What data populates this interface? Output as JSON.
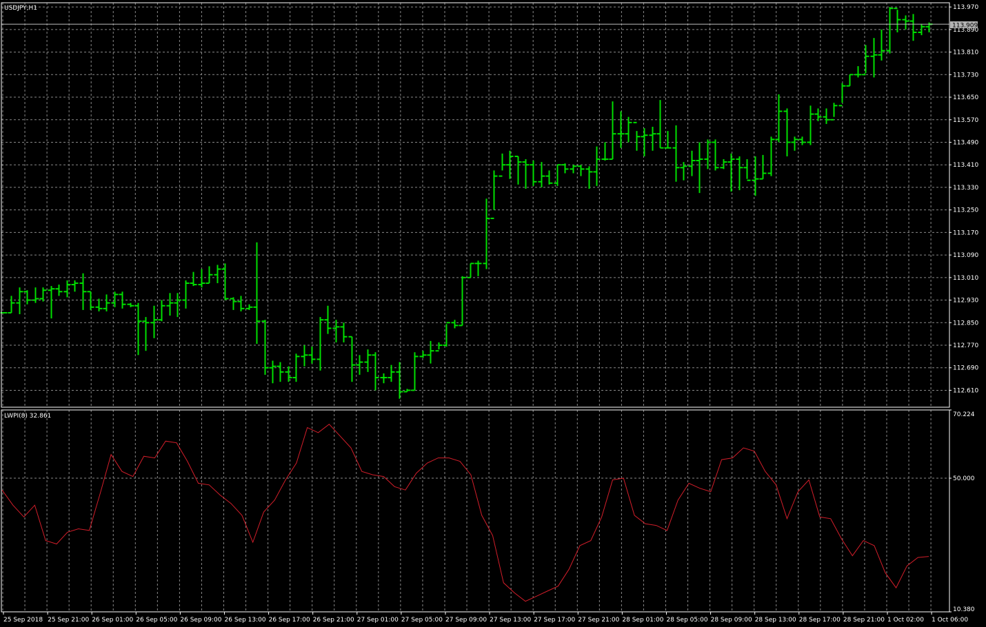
{
  "price_panel": {
    "symbol_label": "USDJPY,H1",
    "current_price_label": "113.909",
    "colors": {
      "bar": "#00e000",
      "grid": "#8a8a8a",
      "price_line": "#c0c0c0",
      "price_tag": "#b3b3b3",
      "frame": "#ffffff",
      "background": "#000000"
    }
  },
  "indicator_panel": {
    "label": "LWPI(8) 32.861",
    "colors": {
      "line": "#d21e2a",
      "level": "#8a8a8a"
    }
  },
  "chart_data": [
    {
      "type": "ohlc",
      "title": "USDJPY,H1",
      "ylim": [
        112.55,
        113.985
      ],
      "y_ticks": [
        "113.970",
        "113.890",
        "113.810",
        "113.730",
        "113.650",
        "113.570",
        "113.490",
        "113.410",
        "113.330",
        "113.250",
        "113.170",
        "113.090",
        "113.010",
        "112.930",
        "112.850",
        "112.770",
        "112.690",
        "112.610"
      ],
      "current_price": 113.909,
      "x_ticks": [
        "25 Sep 2018",
        "25 Sep 21:00",
        "26 Sep 01:00",
        "26 Sep 05:00",
        "26 Sep 09:00",
        "26 Sep 13:00",
        "26 Sep 17:00",
        "26 Sep 21:00",
        "27 Sep 01:00",
        "27 Sep 05:00",
        "27 Sep 09:00",
        "27 Sep 13:00",
        "27 Sep 17:00",
        "27 Sep 21:00",
        "28 Sep 01:00",
        "28 Sep 05:00",
        "28 Sep 09:00",
        "28 Sep 13:00",
        "28 Sep 17:00",
        "28 Sep 21:00",
        "1 Oct 02:00",
        "1 Oct 06:00"
      ],
      "bars": [
        {
          "o": 112.885,
          "h": 112.885,
          "l": 112.885,
          "c": 112.885
        },
        {
          "o": 112.885,
          "h": 112.945,
          "l": 112.885,
          "c": 112.92
        },
        {
          "o": 112.92,
          "h": 112.975,
          "l": 112.88,
          "c": 112.96
        },
        {
          "o": 112.96,
          "h": 112.965,
          "l": 112.915,
          "c": 112.93
        },
        {
          "o": 112.93,
          "h": 112.975,
          "l": 112.92,
          "c": 112.935
        },
        {
          "o": 112.935,
          "h": 112.975,
          "l": 112.925,
          "c": 112.965
        },
        {
          "o": 112.965,
          "h": 112.98,
          "l": 112.865,
          "c": 112.97
        },
        {
          "o": 112.97,
          "h": 112.985,
          "l": 112.945,
          "c": 112.96
        },
        {
          "o": 112.96,
          "h": 113.0,
          "l": 112.94,
          "c": 112.985
        },
        {
          "o": 112.985,
          "h": 113.0,
          "l": 112.96,
          "c": 112.99
        },
        {
          "o": 112.99,
          "h": 113.025,
          "l": 112.895,
          "c": 112.96
        },
        {
          "o": 112.96,
          "h": 112.96,
          "l": 112.895,
          "c": 112.905
        },
        {
          "o": 112.905,
          "h": 112.935,
          "l": 112.89,
          "c": 112.9
        },
        {
          "o": 112.9,
          "h": 112.95,
          "l": 112.89,
          "c": 112.92
        },
        {
          "o": 112.92,
          "h": 112.96,
          "l": 112.905,
          "c": 112.95
        },
        {
          "o": 112.95,
          "h": 112.96,
          "l": 112.9,
          "c": 112.915
        },
        {
          "o": 112.915,
          "h": 112.92,
          "l": 112.905,
          "c": 112.91
        },
        {
          "o": 112.91,
          "h": 112.92,
          "l": 112.735,
          "c": 112.855
        },
        {
          "o": 112.855,
          "h": 112.87,
          "l": 112.75,
          "c": 112.85
        },
        {
          "o": 112.85,
          "h": 112.91,
          "l": 112.795,
          "c": 112.86
        },
        {
          "o": 112.86,
          "h": 112.93,
          "l": 112.855,
          "c": 112.91
        },
        {
          "o": 112.91,
          "h": 112.955,
          "l": 112.875,
          "c": 112.92
        },
        {
          "o": 112.92,
          "h": 112.955,
          "l": 112.87,
          "c": 112.93
        },
        {
          "o": 112.93,
          "h": 113.0,
          "l": 112.9,
          "c": 112.99
        },
        {
          "o": 112.99,
          "h": 113.03,
          "l": 112.98,
          "c": 112.985
        },
        {
          "o": 112.985,
          "h": 113.04,
          "l": 112.975,
          "c": 112.99
        },
        {
          "o": 112.99,
          "h": 113.05,
          "l": 112.99,
          "c": 113.02
        },
        {
          "o": 113.02,
          "h": 113.055,
          "l": 112.99,
          "c": 113.04
        },
        {
          "o": 113.04,
          "h": 113.06,
          "l": 112.93,
          "c": 112.935
        },
        {
          "o": 112.935,
          "h": 112.94,
          "l": 112.895,
          "c": 112.925
        },
        {
          "o": 112.925,
          "h": 112.945,
          "l": 112.89,
          "c": 112.9
        },
        {
          "o": 112.9,
          "h": 112.915,
          "l": 112.895,
          "c": 112.905
        },
        {
          "o": 112.905,
          "h": 113.135,
          "l": 112.775,
          "c": 112.855
        },
        {
          "o": 112.855,
          "h": 112.86,
          "l": 112.665,
          "c": 112.69
        },
        {
          "o": 112.69,
          "h": 112.715,
          "l": 112.635,
          "c": 112.695
        },
        {
          "o": 112.695,
          "h": 112.71,
          "l": 112.64,
          "c": 112.675
        },
        {
          "o": 112.675,
          "h": 112.695,
          "l": 112.64,
          "c": 112.655
        },
        {
          "o": 112.655,
          "h": 112.74,
          "l": 112.64,
          "c": 112.73
        },
        {
          "o": 112.73,
          "h": 112.77,
          "l": 112.695,
          "c": 112.735
        },
        {
          "o": 112.735,
          "h": 112.765,
          "l": 112.705,
          "c": 112.72
        },
        {
          "o": 112.72,
          "h": 112.87,
          "l": 112.68,
          "c": 112.86
        },
        {
          "o": 112.86,
          "h": 112.91,
          "l": 112.81,
          "c": 112.83
        },
        {
          "o": 112.83,
          "h": 112.86,
          "l": 112.78,
          "c": 112.835
        },
        {
          "o": 112.835,
          "h": 112.85,
          "l": 112.78,
          "c": 112.8
        },
        {
          "o": 112.8,
          "h": 112.8,
          "l": 112.64,
          "c": 112.7
        },
        {
          "o": 112.7,
          "h": 112.735,
          "l": 112.665,
          "c": 112.71
        },
        {
          "o": 112.71,
          "h": 112.755,
          "l": 112.675,
          "c": 112.735
        },
        {
          "o": 112.735,
          "h": 112.745,
          "l": 112.61,
          "c": 112.655
        },
        {
          "o": 112.655,
          "h": 112.67,
          "l": 112.635,
          "c": 112.655
        },
        {
          "o": 112.655,
          "h": 112.7,
          "l": 112.64,
          "c": 112.675
        },
        {
          "o": 112.675,
          "h": 112.71,
          "l": 112.58,
          "c": 112.605
        },
        {
          "o": 112.605,
          "h": 112.615,
          "l": 112.605,
          "c": 112.61
        },
        {
          "o": 112.61,
          "h": 112.745,
          "l": 112.61,
          "c": 112.73
        },
        {
          "o": 112.73,
          "h": 112.75,
          "l": 112.725,
          "c": 112.735
        },
        {
          "o": 112.735,
          "h": 112.785,
          "l": 112.705,
          "c": 112.75
        },
        {
          "o": 112.75,
          "h": 112.78,
          "l": 112.755,
          "c": 112.77
        },
        {
          "o": 112.77,
          "h": 112.845,
          "l": 112.765,
          "c": 112.85
        },
        {
          "o": 112.85,
          "h": 112.86,
          "l": 112.83,
          "c": 112.84
        },
        {
          "o": 112.84,
          "h": 113.015,
          "l": 112.84,
          "c": 113.01
        },
        {
          "o": 113.01,
          "h": 113.06,
          "l": 113.01,
          "c": 113.06
        },
        {
          "o": 113.06,
          "h": 113.07,
          "l": 113.015,
          "c": 113.06
        },
        {
          "o": 113.06,
          "h": 113.29,
          "l": 113.04,
          "c": 113.22
        },
        {
          "o": 113.22,
          "h": 113.39,
          "l": 113.25,
          "c": 113.37
        },
        {
          "o": 113.37,
          "h": 113.45,
          "l": 113.39,
          "c": 113.41
        },
        {
          "o": 113.41,
          "h": 113.46,
          "l": 113.36,
          "c": 113.44
        },
        {
          "o": 113.44,
          "h": 113.44,
          "l": 113.34,
          "c": 113.42
        },
        {
          "o": 113.42,
          "h": 113.43,
          "l": 113.325,
          "c": 113.41
        },
        {
          "o": 113.41,
          "h": 113.425,
          "l": 113.335,
          "c": 113.35
        },
        {
          "o": 113.35,
          "h": 113.42,
          "l": 113.33,
          "c": 113.37
        },
        {
          "o": 113.37,
          "h": 113.39,
          "l": 113.34,
          "c": 113.345
        },
        {
          "o": 113.345,
          "h": 113.41,
          "l": 113.335,
          "c": 113.41
        },
        {
          "o": 113.41,
          "h": 113.415,
          "l": 113.38,
          "c": 113.395
        },
        {
          "o": 113.395,
          "h": 113.41,
          "l": 113.38,
          "c": 113.405
        },
        {
          "o": 113.405,
          "h": 113.41,
          "l": 113.37,
          "c": 113.395
        },
        {
          "o": 113.395,
          "h": 113.405,
          "l": 113.325,
          "c": 113.385
        },
        {
          "o": 113.385,
          "h": 113.475,
          "l": 113.335,
          "c": 113.43
        },
        {
          "o": 113.43,
          "h": 113.49,
          "l": 113.425,
          "c": 113.43
        },
        {
          "o": 113.43,
          "h": 113.635,
          "l": 113.43,
          "c": 113.52
        },
        {
          "o": 113.52,
          "h": 113.6,
          "l": 113.47,
          "c": 113.52
        },
        {
          "o": 113.52,
          "h": 113.58,
          "l": 113.49,
          "c": 113.56
        },
        {
          "o": 113.56,
          "h": 113.53,
          "l": 113.46,
          "c": 113.51
        },
        {
          "o": 113.51,
          "h": 113.54,
          "l": 113.44,
          "c": 113.515
        },
        {
          "o": 113.515,
          "h": 113.545,
          "l": 113.46,
          "c": 113.52
        },
        {
          "o": 113.52,
          "h": 113.64,
          "l": 113.47,
          "c": 113.47
        },
        {
          "o": 113.47,
          "h": 113.53,
          "l": 113.47,
          "c": 113.47
        },
        {
          "o": 113.47,
          "h": 113.55,
          "l": 113.35,
          "c": 113.4
        },
        {
          "o": 113.4,
          "h": 113.42,
          "l": 113.355,
          "c": 113.405
        },
        {
          "o": 113.405,
          "h": 113.46,
          "l": 113.37,
          "c": 113.425
        },
        {
          "o": 113.425,
          "h": 113.49,
          "l": 113.31,
          "c": 113.43
        },
        {
          "o": 113.43,
          "h": 113.5,
          "l": 113.395,
          "c": 113.49
        },
        {
          "o": 113.49,
          "h": 113.5,
          "l": 113.39,
          "c": 113.4
        },
        {
          "o": 113.4,
          "h": 113.43,
          "l": 113.395,
          "c": 113.42
        },
        {
          "o": 113.42,
          "h": 113.45,
          "l": 113.315,
          "c": 113.43
        },
        {
          "o": 113.43,
          "h": 113.44,
          "l": 113.32,
          "c": 113.4
        },
        {
          "o": 113.4,
          "h": 113.43,
          "l": 113.36,
          "c": 113.355
        },
        {
          "o": 113.355,
          "h": 113.44,
          "l": 113.3,
          "c": 113.36
        },
        {
          "o": 113.36,
          "h": 113.445,
          "l": 113.36,
          "c": 113.38
        },
        {
          "o": 113.38,
          "h": 113.51,
          "l": 113.37,
          "c": 113.5
        },
        {
          "o": 113.5,
          "h": 113.66,
          "l": 113.49,
          "c": 113.6
        },
        {
          "o": 113.6,
          "h": 113.61,
          "l": 113.44,
          "c": 113.49
        },
        {
          "o": 113.49,
          "h": 113.51,
          "l": 113.46,
          "c": 113.5
        },
        {
          "o": 113.5,
          "h": 113.51,
          "l": 113.48,
          "c": 113.49
        },
        {
          "o": 113.49,
          "h": 113.62,
          "l": 113.48,
          "c": 113.59
        },
        {
          "o": 113.59,
          "h": 113.61,
          "l": 113.565,
          "c": 113.58
        },
        {
          "o": 113.58,
          "h": 113.61,
          "l": 113.555,
          "c": 113.57
        },
        {
          "o": 113.57,
          "h": 113.63,
          "l": 113.58,
          "c": 113.62
        },
        {
          "o": 113.62,
          "h": 113.7,
          "l": 113.63,
          "c": 113.69
        },
        {
          "o": 113.69,
          "h": 113.73,
          "l": 113.69,
          "c": 113.73
        },
        {
          "o": 113.73,
          "h": 113.76,
          "l": 113.72,
          "c": 113.73
        },
        {
          "o": 113.73,
          "h": 113.835,
          "l": 113.735,
          "c": 113.795
        },
        {
          "o": 113.795,
          "h": 113.86,
          "l": 113.72,
          "c": 113.8
        },
        {
          "o": 113.8,
          "h": 113.89,
          "l": 113.78,
          "c": 113.815
        },
        {
          "o": 113.815,
          "h": 113.97,
          "l": 113.805,
          "c": 113.965
        },
        {
          "o": 113.965,
          "h": 113.96,
          "l": 113.88,
          "c": 113.925
        },
        {
          "o": 113.925,
          "h": 113.94,
          "l": 113.89,
          "c": 113.92
        },
        {
          "o": 113.92,
          "h": 113.945,
          "l": 113.85,
          "c": 113.88
        },
        {
          "o": 113.88,
          "h": 113.91,
          "l": 113.87,
          "c": 113.9
        },
        {
          "o": 113.9,
          "h": 113.915,
          "l": 113.88,
          "c": 113.909
        }
      ]
    },
    {
      "type": "line",
      "title": "LWPI(8) 32.861",
      "ylim": [
        10.38,
        70.224
      ],
      "y_ticks": [
        "70.224",
        "50.000",
        "10.380"
      ],
      "level": 50.0,
      "series": [
        {
          "values": [
            46.5,
            42.0,
            38.5,
            42.0,
            31.5,
            30.5,
            34.0,
            35.0,
            34.5,
            45.5,
            57.0,
            52.0,
            50.5,
            56.5,
            56.0,
            61.0,
            60.5,
            55.0,
            48.5,
            48.0,
            45.0,
            42.5,
            39.0,
            31.0,
            40.0,
            43.5,
            49.5,
            54.5,
            65.0,
            63.5,
            66.0,
            62.5,
            59.0,
            52.0,
            51.0,
            50.5,
            47.5,
            46.5,
            51.5,
            54.5,
            56.0,
            56.0,
            55.0,
            51.0,
            39.0,
            33.0,
            19.0,
            16.0,
            13.5,
            15.0,
            16.5,
            18.0,
            23.0,
            30.0,
            31.5,
            38.5,
            49.5,
            50.0,
            39.0,
            36.5,
            36.0,
            34.5,
            43.5,
            48.5,
            47.0,
            46.0,
            55.5,
            56.0,
            59.0,
            58.0,
            52.0,
            48.0,
            38.0,
            46.0,
            49.5,
            38.5,
            38.0,
            32.0,
            27.0,
            31.5,
            30.0,
            22.0,
            17.5,
            24.0,
            26.5,
            26.8
          ]
        }
      ]
    }
  ]
}
